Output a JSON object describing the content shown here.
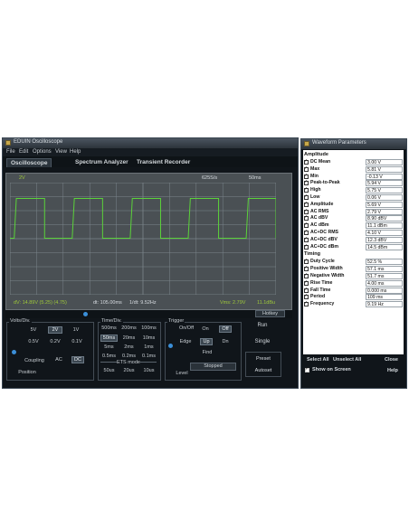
{
  "osc": {
    "title": "EDUIN Oscilloscope",
    "menu": [
      "File",
      "Edit",
      "Options",
      "View",
      "Help"
    ],
    "tabs": [
      "Oscilloscope",
      "Spectrum Analyzer",
      "Transient Recorder"
    ],
    "scope": {
      "channel": "2V",
      "samples": "625S/s",
      "timebase": "50ms",
      "readout_left": "dV: 14.89V (5.25) (4.75)",
      "readout_mid": "dt: 105.00ms",
      "readout_mid2": "1/dt: 9.52Hz",
      "readout_right": "Vms: 2.79V",
      "readout_right2": "11.1dBu",
      "hotkey": "Hotkey"
    },
    "volts": {
      "label": "Volts/Div.",
      "row1": [
        "5V",
        "2V",
        "1V"
      ],
      "row2": [
        "0.5V",
        "0.2V",
        "0.1V"
      ],
      "coupling_label": "Coupling",
      "coupling": [
        "AC",
        "DC"
      ],
      "position_label": "Position"
    },
    "time": {
      "label": "Time/Div.",
      "row1": [
        "500ms",
        "200ms",
        "100ms"
      ],
      "row2": [
        "50ms",
        "20ms",
        "10ms"
      ],
      "row3": [
        "5ms",
        "2ms",
        "1ms"
      ],
      "row4": [
        "0.5ms",
        "0.2ms",
        "0.1ms"
      ],
      "ets_label": "ETS mode",
      "row5": [
        "50us",
        "20us",
        "10us"
      ]
    },
    "trigger": {
      "label": "Trigger",
      "onoff_label": "On/Off",
      "onoff": [
        "On",
        "Off"
      ],
      "edge_label": "Edge",
      "edge": [
        "Up",
        "Dn"
      ],
      "find": "Find",
      "level_label": "Level",
      "status": "Stopped"
    },
    "actions": {
      "run": "Run",
      "single": "Single",
      "preset": "Preset",
      "autoset": "Autoset"
    }
  },
  "params": {
    "title": "Waveform Parameters",
    "amplitude_head": "Amplitude",
    "amplitude": [
      {
        "name": "DC Mean",
        "value": "3.00 V"
      },
      {
        "name": "Max",
        "value": "5.81 V"
      },
      {
        "name": "Min",
        "value": "-0.13 V"
      },
      {
        "name": "Peak-to-Peak",
        "value": "5.94 V"
      },
      {
        "name": "High",
        "value": "5.75 V"
      },
      {
        "name": "Low",
        "value": "0.06 V"
      },
      {
        "name": "Amplitude",
        "value": "5.69 V"
      },
      {
        "name": "AC RMS",
        "value": "2.79 V"
      },
      {
        "name": "AC dBV",
        "value": "8.90 dBV"
      },
      {
        "name": "AC dBm",
        "value": "11.1 dBm"
      },
      {
        "name": "AC+DC RMS",
        "value": "4.10 V"
      },
      {
        "name": "AC+DC dBV",
        "value": "12.3 dBV"
      },
      {
        "name": "AC+DC dBm",
        "value": "14.5 dBm"
      }
    ],
    "timing_head": "Timing",
    "timing": [
      {
        "name": "Duty Cycle",
        "value": "52.5 %"
      },
      {
        "name": "Positive Width",
        "value": "57.1 ms"
      },
      {
        "name": "Negative Width",
        "value": "51.7 ms"
      },
      {
        "name": "Rise Time",
        "value": "4.00 ms"
      },
      {
        "name": "Fall Time",
        "value": "0.000 ms"
      },
      {
        "name": "Period",
        "value": "109 ms"
      },
      {
        "name": "Frequency",
        "value": "9.19 Hz"
      }
    ],
    "select_all": "Select All",
    "unselect_all": "Unselect All",
    "close": "Close",
    "show_on_screen": "Show on Screen",
    "help": "Help"
  },
  "colors": {
    "trace": "#5bd23a",
    "grid": "#7c868c",
    "window_bg": "#10151a"
  }
}
